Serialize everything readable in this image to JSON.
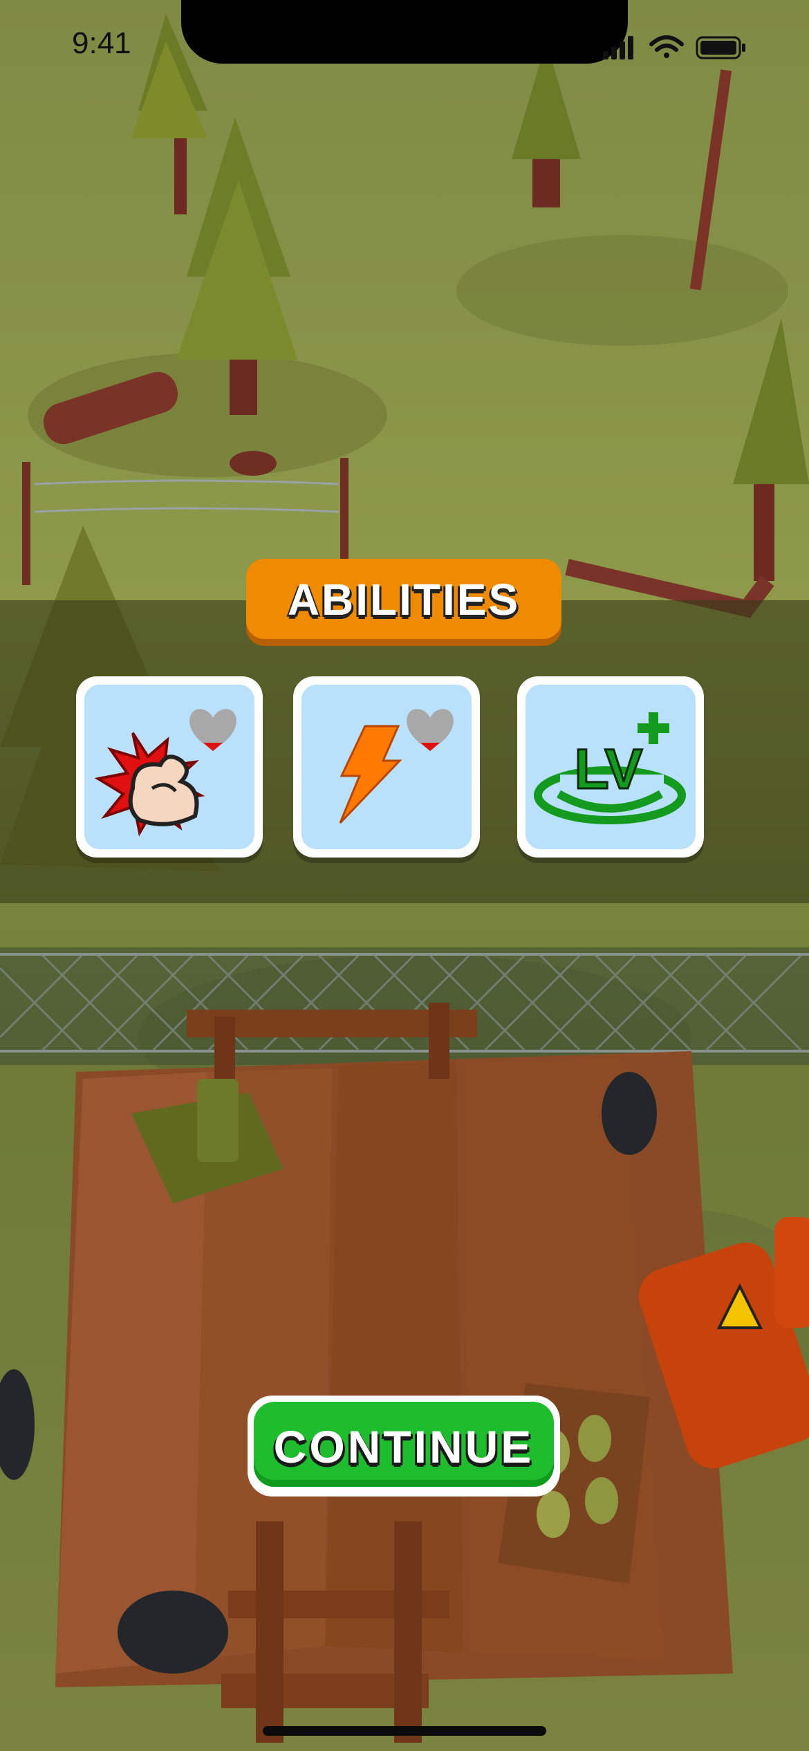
{
  "status_bar": {
    "time": "9:41"
  },
  "abilities": {
    "title": "ABILITIES",
    "cards": [
      {
        "icon": "strength-flex-icon",
        "badge_icon": "heart-icon"
      },
      {
        "icon": "lightning-bolt-icon",
        "badge_icon": "heart-icon"
      },
      {
        "icon": "level-up-icon",
        "text": "LV"
      }
    ]
  },
  "continue_button": {
    "label": "CONTINUE"
  },
  "colors": {
    "title_orange": "#F08A00",
    "continue_green": "#1DBD2E",
    "card_blue": "#B9E1FB",
    "lightning_orange": "#FF7A00",
    "level_green": "#139A1F",
    "heart_red": "#E01010"
  }
}
